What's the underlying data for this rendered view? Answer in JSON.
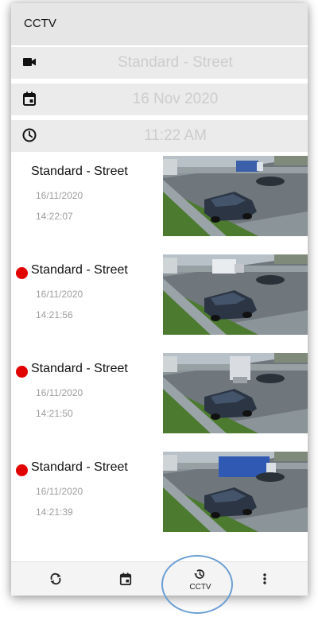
{
  "app": {
    "title": "CCTV"
  },
  "filters": {
    "camera": {
      "icon": "videocam-icon",
      "value": "Standard - Street"
    },
    "date": {
      "icon": "calendar-icon",
      "value": "16 Nov 2020"
    },
    "time": {
      "icon": "clock-icon",
      "value": "11:22 AM"
    }
  },
  "events": [
    {
      "title": "Standard - Street",
      "date": "16/11/2020",
      "time": "14:22:07",
      "unread": false,
      "thumbnail": "street-camera-snapshot"
    },
    {
      "title": "Standard - Street",
      "date": "16/11/2020",
      "time": "14:21:56",
      "unread": true,
      "thumbnail": "street-camera-snapshot"
    },
    {
      "title": "Standard - Street",
      "date": "16/11/2020",
      "time": "14:21:50",
      "unread": true,
      "thumbnail": "street-camera-snapshot"
    },
    {
      "title": "Standard - Street",
      "date": "16/11/2020",
      "time": "14:21:39",
      "unread": true,
      "thumbnail": "street-camera-snapshot"
    }
  ],
  "nav": {
    "refresh_icon": "refresh-icon",
    "calendar_icon": "calendar-icon",
    "cctv_icon": "history-icon",
    "cctv_label": "CCTV",
    "more_icon": "more-vert-icon"
  },
  "colors": {
    "unread_dot": "#e10000",
    "appbar": "#e6e6e6",
    "highlight_ring": "#6a9ed3"
  }
}
